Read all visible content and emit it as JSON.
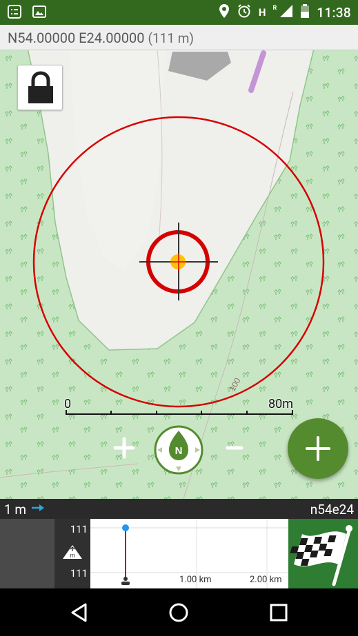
{
  "status_bar": {
    "time": "11:38",
    "network_letter": "H",
    "roaming_letter": "R",
    "icons": [
      "notification-list-icon",
      "image-icon",
      "location-icon",
      "alarm-icon",
      "signal-icon",
      "battery-icon"
    ]
  },
  "coord_bar": {
    "coordinates": "N54.00000 E24.00000",
    "accuracy": "(111 m)"
  },
  "map": {
    "road_label": "100",
    "scale_start": "0",
    "scale_end": "80m",
    "lock_icon": "lock-icon",
    "compass_letter": "N",
    "zoom_in_symbol": "+",
    "zoom_out_symbol": "-",
    "fab_symbol": "+"
  },
  "elevation": {
    "distance": "1 m",
    "track_name": "n54e24",
    "elev_top": "111",
    "elev_bottom": "111",
    "elev_unit": "m",
    "km_1": "1.00 km",
    "km_2": "2.00 km"
  },
  "colors": {
    "status_bar": "#33691e",
    "map_forest": "#c9e6c4",
    "accuracy_circle": "#d50000",
    "fab": "#558b2f",
    "finish_flag_bg": "#2e7d32"
  }
}
